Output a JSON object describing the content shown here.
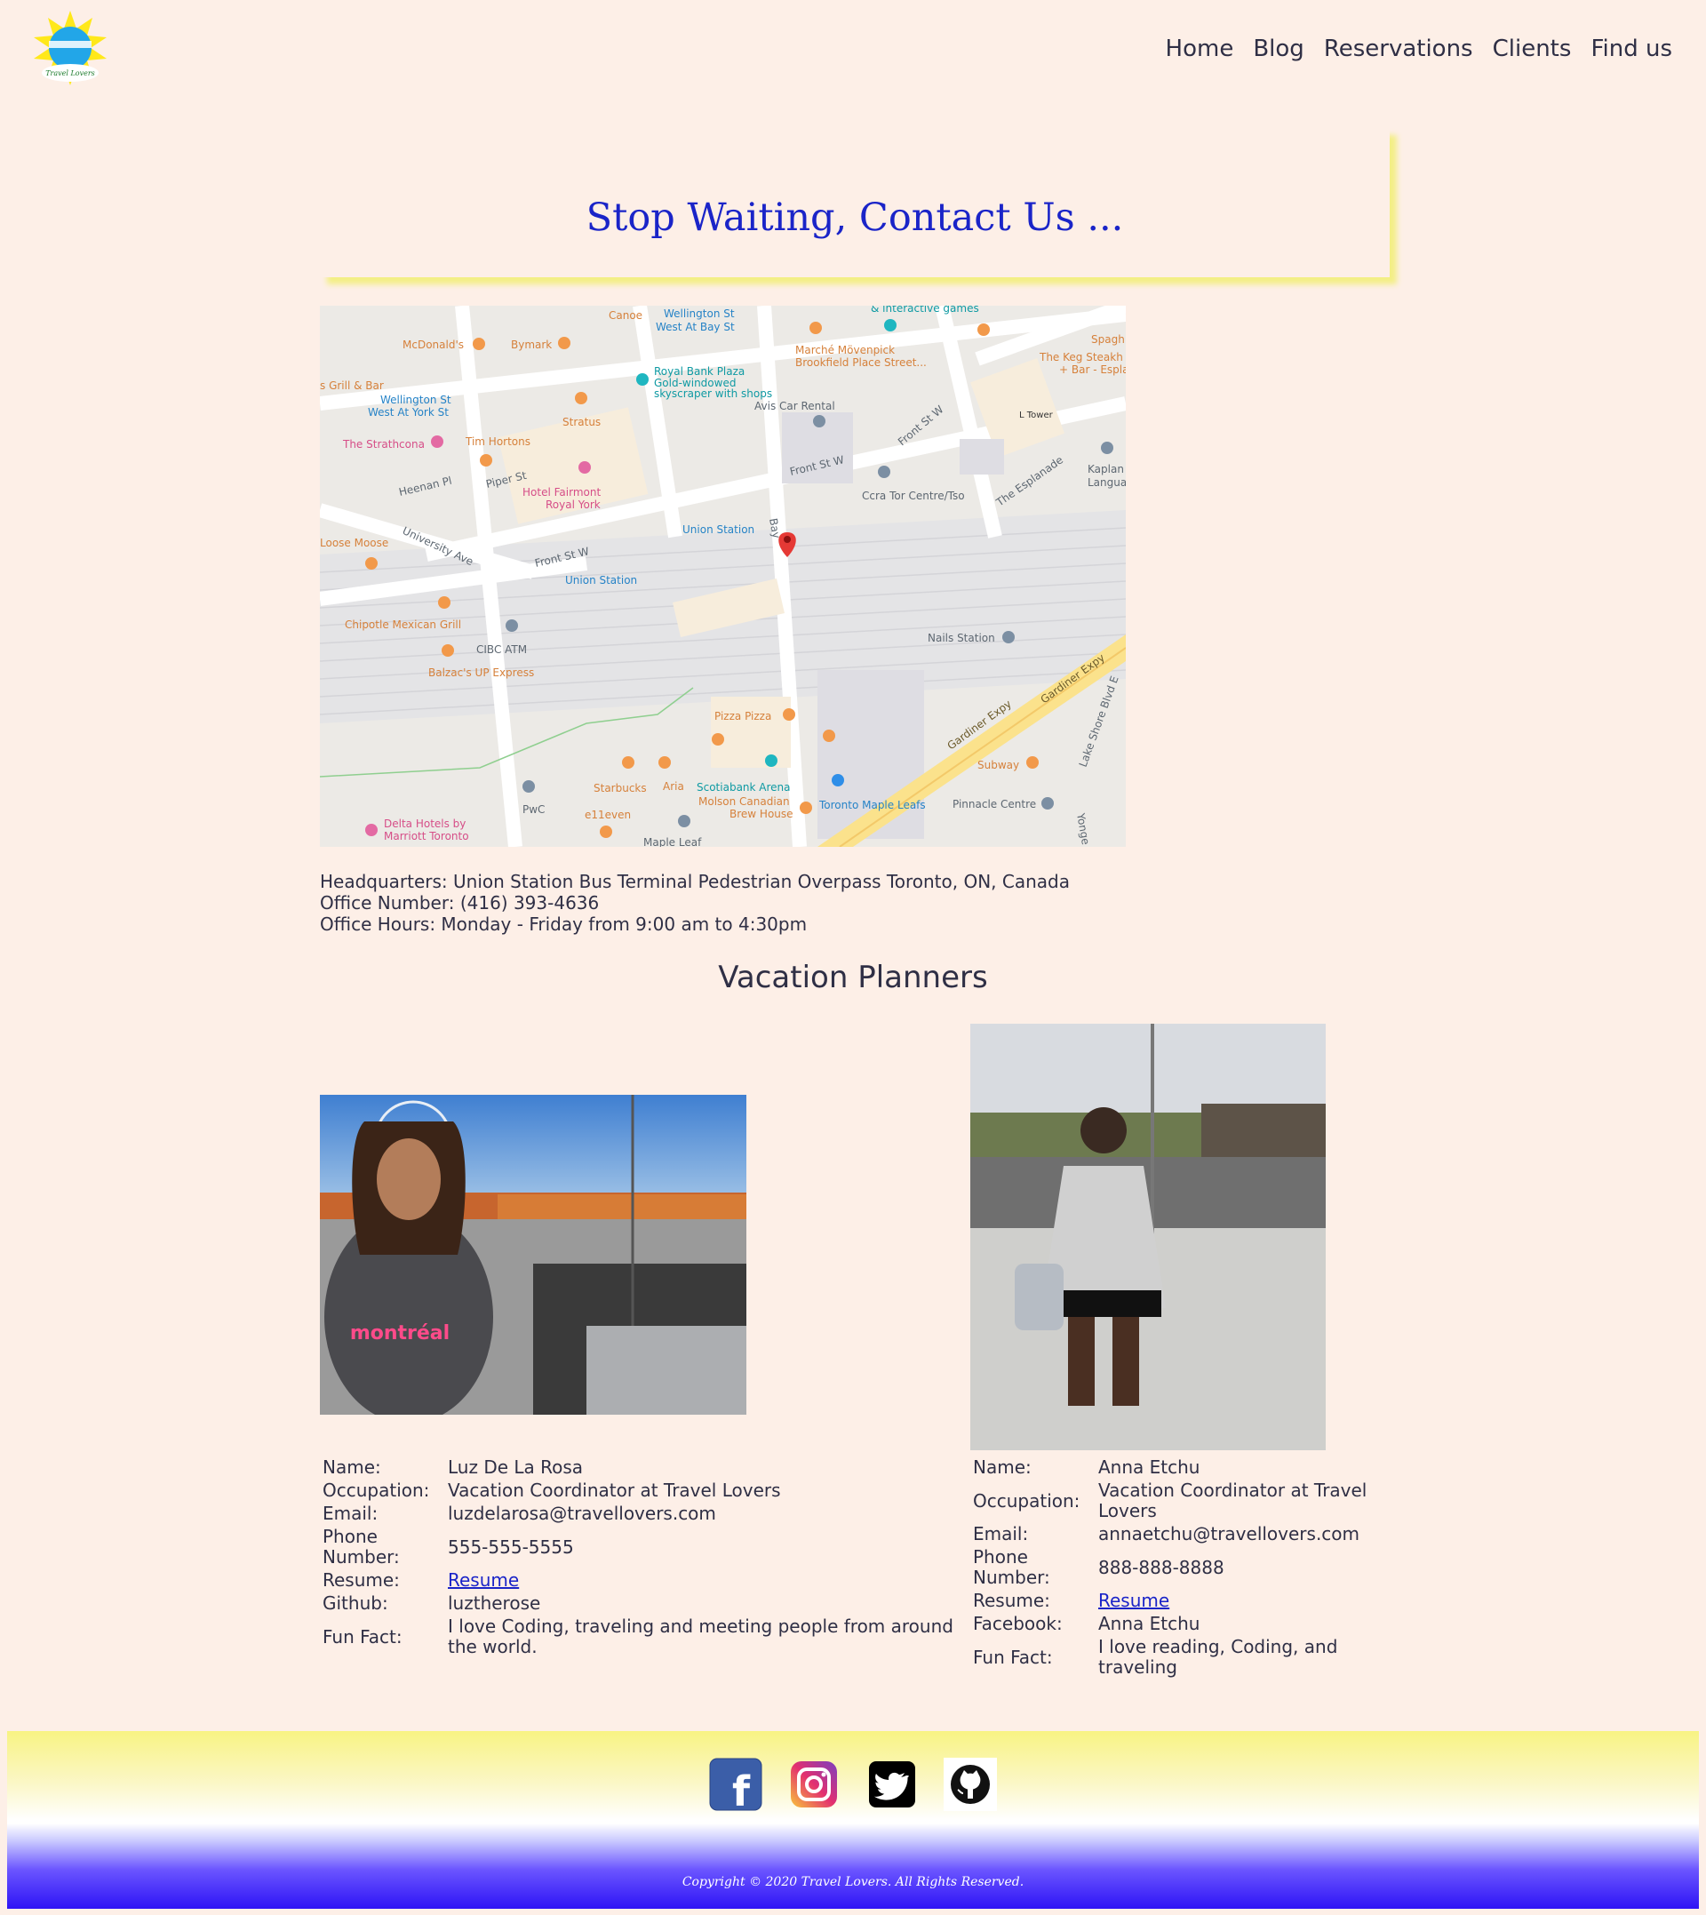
{
  "header": {
    "logo_text": "Travel Lovers",
    "nav": [
      "Home",
      "Blog",
      "Reservations",
      "Clients",
      "Find us"
    ]
  },
  "hero": {
    "title": "Stop Waiting, Contact Us ..."
  },
  "map": {
    "labels": {
      "mcdonalds": "McDonald's",
      "bymark": "Bymark",
      "canoe": "Canoe",
      "wellington1a": "Wellington St",
      "wellington1b": "West At Bay St",
      "interactive": "& interactive games",
      "marche1": "Marché Mövenpick",
      "marche2": "Brookfield Place Street...",
      "spagh": "Spagh",
      "keg1": "The Keg Steakh",
      "keg2": "+ Bar - Espla",
      "grill": "s Grill & Bar",
      "wellington2a": "Wellington St",
      "wellington2b": "West At York St",
      "rbp": "Royal Bank Plaza",
      "rbp2": "Gold-windowed",
      "rbp3": "skyscraper with shops",
      "stratus": "Stratus",
      "avis": "Avis Car Rental",
      "ltower": "L Tower",
      "strathcona": "The Strathcona",
      "timhortons": "Tim Hortons",
      "frontstw1": "Front St W",
      "frontstw2": "Front St W",
      "frontstw3": "Front St W",
      "kaplan1": "Kaplan",
      "kaplan2": "Langua",
      "heenan": "Heenan Pl",
      "piper": "Piper St",
      "fairmont1": "Hotel Fairmont",
      "fairmont2": "Royal York",
      "ccra": "Ccra Tor Centre/Tso",
      "esplanade": "The Esplanade",
      "loosemoose": "Loose Moose",
      "university": "University Ave",
      "unionstation1": "Union Station",
      "unionstation2": "Union Station",
      "bay": "Bay",
      "chipotle": "Chipotle Mexican Grill",
      "cibc": "CIBC ATM",
      "balzac": "Balzac's UP Express",
      "nails": "Nails Station",
      "gardiner1": "Gardiner Expy",
      "gardiner2": "Gardiner Expy",
      "lakeshore": "Lake Shore Blvd E",
      "pizzapizza": "Pizza Pizza",
      "starbucks": "Starbucks",
      "aria": "Aria",
      "scotiabank": "Scotiabank Arena",
      "molson1": "Molson Canadian",
      "molson2": "Brew House",
      "mapleleafs": "Toronto Maple Leafs",
      "subway": "Subway",
      "pinnacle": "Pinnacle Centre",
      "pwc": "PwC",
      "e11even": "e11even",
      "delta1": "Delta Hotels by",
      "delta2": "Marriott Toronto",
      "mapleleaf": "Maple Leaf",
      "yonge": "Yonge"
    }
  },
  "contact": {
    "headquarters": "Headquarters: Union Station Bus Terminal Pedestrian Overpass Toronto, ON, Canada",
    "office_number": "Office Number: (416) 393-4636",
    "office_hours": "Office Hours: Monday - Friday from 9:00 am to 4:30pm"
  },
  "planners": {
    "title": "Vacation Planners",
    "people": [
      {
        "name_label": "Name:",
        "name": "Luz De La Rosa",
        "occupation_label": "Occupation:",
        "occupation": "Vacation Coordinator at Travel Lovers",
        "email_label": "Email:",
        "email": "luzdelarosa@travellovers.com",
        "phone_label": "Phone Number:",
        "phone": "555-555-5555",
        "resume_label": "Resume:",
        "resume": "Resume",
        "social_label": "Github:",
        "social": "luztherose",
        "fun_label": "Fun Fact:",
        "fun": "I love Coding, traveling and meeting people from around the world.",
        "photo_text": "montréal"
      },
      {
        "name_label": "Name:",
        "name": "Anna Etchu",
        "occupation_label": "Occupation:",
        "occupation": "Vacation Coordinator at Travel Lovers",
        "email_label": "Email:",
        "email": "annaetchu@travellovers.com",
        "phone_label": "Phone Number:",
        "phone": "888-888-8888",
        "resume_label": "Resume:",
        "resume": "Resume",
        "social_label": "Facebook:",
        "social": "Anna Etchu",
        "fun_label": "Fun Fact:",
        "fun": "I love reading, Coding, and traveling"
      }
    ]
  },
  "footer": {
    "social_icons": [
      "facebook-icon",
      "instagram-icon",
      "twitter-icon",
      "github-icon"
    ],
    "facebook_glyph": "f",
    "copyright": "Copyright © 2020 Travel Lovers. All Rights Reserved."
  }
}
